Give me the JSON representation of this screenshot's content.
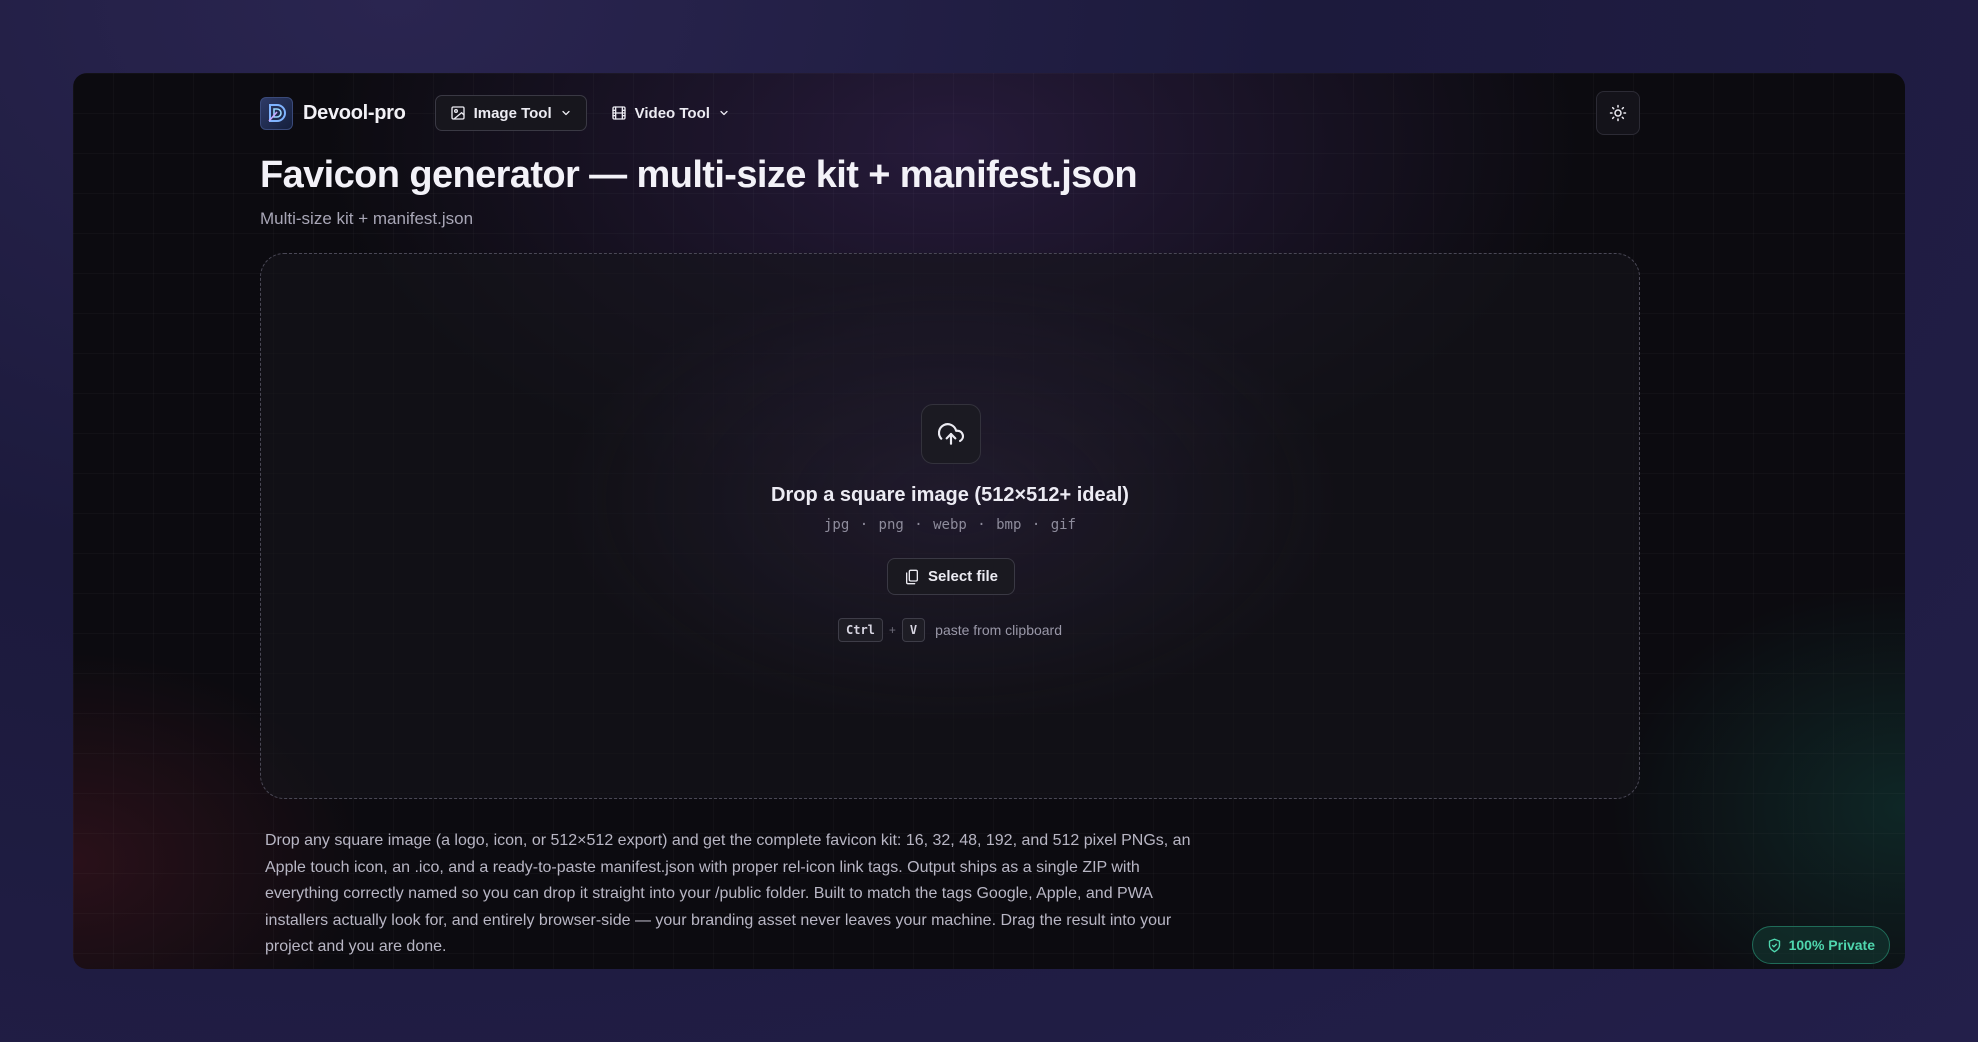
{
  "brand": {
    "name": "Devool-pro"
  },
  "nav": {
    "image_tool": "Image Tool",
    "video_tool": "Video Tool"
  },
  "page": {
    "title": "Favicon generator — multi-size kit + manifest.json",
    "subtitle": "Multi-size kit + manifest.json"
  },
  "dropzone": {
    "title": "Drop a square image (512×512+ ideal)",
    "formats": "jpg · png · webp · bmp · gif",
    "select_label": "Select file",
    "kbd_ctrl": "Ctrl",
    "kbd_plus": "+",
    "kbd_v": "V",
    "paste_label": "paste from clipboard"
  },
  "description": "Drop any square image (a logo, icon, or 512×512 export) and get the complete favicon kit: 16, 32, 48, 192, and 512 pixel PNGs, an Apple touch icon, an .ico, and a ready-to-paste manifest.json with proper rel-icon link tags. Output ships as a single ZIP with everything correctly named so you can drop it straight into your /public folder. Built to match the tags Google, Apple, and PWA installers actually look for, and entirely browser-side — your branding asset never leaves your machine. Drag the result into your project and you are done.",
  "privacy_badge": "100% Private",
  "colors": {
    "accent_green": "#4fd6ae",
    "background": "#0c0b10",
    "outer_background": "#1c1a3c"
  }
}
